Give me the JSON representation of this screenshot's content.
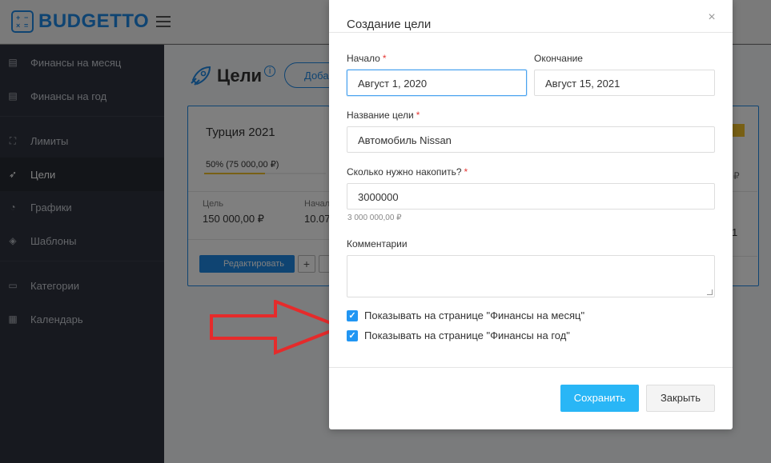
{
  "app": {
    "logo_text": "BUDGETTO"
  },
  "sidebar": {
    "items": [
      {
        "label": "Финансы на месяц",
        "icon": "finance-month-icon"
      },
      {
        "label": "Финансы на год",
        "icon": "finance-year-icon"
      },
      {
        "label": "Лимиты",
        "icon": "limits-icon"
      },
      {
        "label": "Цели",
        "icon": "rocket-icon",
        "active": true
      },
      {
        "label": "Графики",
        "icon": "pie-chart-icon"
      },
      {
        "label": "Шаблоны",
        "icon": "layers-icon"
      },
      {
        "label": "Категории",
        "icon": "categories-icon"
      },
      {
        "label": "Календарь",
        "icon": "calendar-icon"
      }
    ]
  },
  "page": {
    "title": "Цели",
    "add_button": "Доба"
  },
  "goal_card": {
    "title": "Турция 2021",
    "progress_label": "50% (75 000,00 ₽)",
    "progress_fraction": 0.5,
    "target_label": "Цель",
    "target_value": "150 000,00 ₽",
    "start_label": "Начал",
    "start_value": "10.07",
    "edit_button": "Редактировать",
    "plus_button": "+"
  },
  "second_card": {
    "partial_amount": "₽",
    "partial_number": "1"
  },
  "modal": {
    "title": "Создание цели",
    "close_symbol": "×",
    "start_label": "Начало",
    "start_value": "Август 1, 2020",
    "end_label": "Окончание",
    "end_value": "Август 15, 2021",
    "name_label": "Название цели",
    "name_value": "Автомобиль Nissan",
    "amount_label": "Сколько нужно накопить?",
    "amount_value": "3000000",
    "amount_hint": "3 000 000,00 ₽",
    "comments_label": "Комментарии",
    "required_mark": "*",
    "checkbox_month": "Показывать на странице \"Финансы на месяц\"",
    "checkbox_year": "Показывать на странице \"Финансы на год\"",
    "save_button": "Сохранить",
    "close_button": "Закрыть"
  },
  "colors": {
    "accent": "#1e88e5",
    "sidebar_bg": "#2f333e",
    "save_button": "#29b6f6",
    "checkbox": "#2196f3",
    "arrow": "#e52b2b",
    "progress": "#f0c02a"
  }
}
